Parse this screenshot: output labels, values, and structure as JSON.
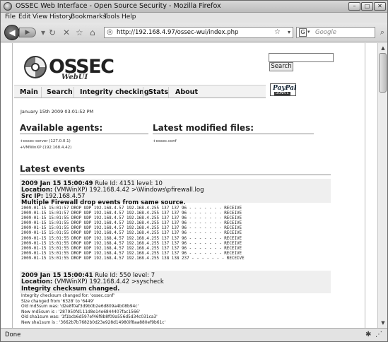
{
  "window": {
    "title": "OSSEC Web Interface - Open Source Security - Mozilla Firefox",
    "controls": {
      "minimize": "–",
      "maximize": "□",
      "close": "✕"
    }
  },
  "menu": [
    "File",
    "Edit",
    "View",
    "History",
    "Bookmarks",
    "Tools",
    "Help"
  ],
  "nav": {
    "url": "http://192.168.4.97/ossec-wui/index.php",
    "search_placeholder": "Google",
    "search_engine_letter": "G"
  },
  "page": {
    "logo": {
      "brand": "OSSEC",
      "sub": "WebUI"
    },
    "search_button": "Search",
    "tabs": [
      "Main",
      "Search",
      "Integrity checking",
      "Stats",
      "About"
    ],
    "paypal": {
      "label": "PayPal",
      "donate": "DONATE"
    },
    "date": "January 15th 2009 03:01:52 PM",
    "agents_title": "Available agents:",
    "agents": [
      "+ossec-server (127.0.0.1)",
      "+VMWinXP (192.168.4.42)"
    ],
    "files_title": "Latest modified files:",
    "files": [
      "+ossec.conf"
    ],
    "events_title": "Latest events",
    "events": [
      {
        "date": "2009 Jan 15 15:00:49",
        "rule_label": "Rule Id:",
        "rule_id": "4151",
        "level_label": "level:",
        "level": "10",
        "location_label": "Location:",
        "location": "(VMWinXP) 192.168.4.42 >\\Windows\\pfirewall.log",
        "srcip_label": "Src IP:",
        "srcip": "192.168.4.57",
        "description": "Multiple Firewall drop events from same source.",
        "log": [
          "2009-01-15 15:01:57 DROP UDP 192.168.4.57 192.168.4.255 137 137 96 - - - - - - - RECEIVE",
          "2009-01-15 15:01:57 DROP UDP 192.168.4.57 192.168.4.255 137 137 96 - - - - - - - RECEIVE",
          "2009-01-15 15:01:55 DROP UDP 192.168.4.57 192.168.4.255 137 137 96 - - - - - - - RECEIVE",
          "2009-01-15 15:01:55 DROP UDP 192.168.4.57 192.168.4.255 137 137 96 - - - - - - - RECEIVE",
          "2009-01-15 15:01:55 DROP UDP 192.168.4.57 192.168.4.255 137 137 96 - - - - - - - RECEIVE",
          "2009-01-15 15:01:55 DROP UDP 192.168.4.57 192.168.4.255 137 137 96 - - - - - - - RECEIVE",
          "2009-01-15 15:01:55 DROP UDP 192.168.4.57 192.168.4.255 137 137 96 - - - - - - - RECEIVE",
          "2009-01-15 15:01:55 DROP UDP 192.168.4.57 192.168.4.255 137 137 96 - - - - - - - RECEIVE",
          "2009-01-15 15:01:55 DROP UDP 192.168.4.57 192.168.4.255 137 137 96 - - - - - - - RECEIVE",
          "2009-01-15 15:01:55 DROP UDP 192.168.4.57 192.168.4.255 137 137 96 - - - - - - - RECEIVE",
          "2009-01-15 15:01:55 DROP UDP 192.168.4.57 192.168.4.255 138 138 237 - - - - - - - RECEIVE"
        ]
      },
      {
        "date": "2009 Jan 15 15:00:41",
        "rule_label": "Rule Id:",
        "rule_id": "550",
        "level_label": "level:",
        "level": "7",
        "location_label": "Location:",
        "location": "(VMWinXP) 192.168.4.42 >syscheck",
        "description": "Integrity checksum changed.",
        "log": [
          "Integrity checksum changed for: 'ossec.conf'",
          "Size changed from '6328' to '6449'",
          "Old md5sum was: 'd2e8f0af3d9b0b2e6d809a4b08b94c'",
          "New md5sum is : '287950fd111d8e14e6844407fac1566'",
          "Old sha1sum was: '1f1bcb6d597ef46f8b8f09a556d5d34c031ca3'",
          "New sha1sum is : '3662b7b7682b0d23e928d14980if8aa880ef9b61c'"
        ]
      }
    ]
  },
  "status": {
    "text": "Done"
  }
}
